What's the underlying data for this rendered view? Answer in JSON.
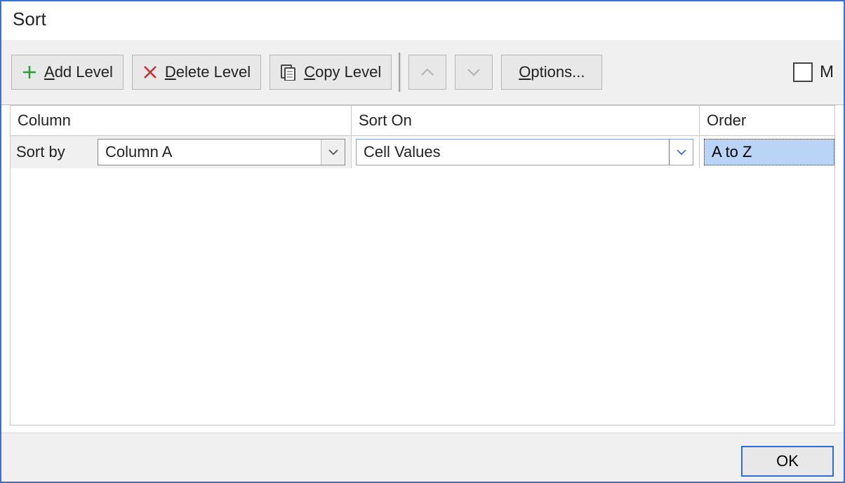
{
  "dialog": {
    "title": "Sort"
  },
  "toolbar": {
    "add_level": {
      "accel": "A",
      "rest": "dd Level"
    },
    "delete_level": {
      "accel": "D",
      "rest": "elete Level"
    },
    "copy_level": {
      "accel": "C",
      "rest": "opy Level"
    },
    "options": {
      "accel": "O",
      "rest": "ptions..."
    },
    "headers_label_first": "M"
  },
  "grid": {
    "headers": {
      "column": "Column",
      "sort_on": "Sort On",
      "order": "Order"
    },
    "rows": [
      {
        "label": "Sort by",
        "column_value": "Column A",
        "sort_on_value": "Cell Values",
        "order_value": "A to Z"
      }
    ]
  },
  "footer": {
    "ok_label": "OK"
  }
}
